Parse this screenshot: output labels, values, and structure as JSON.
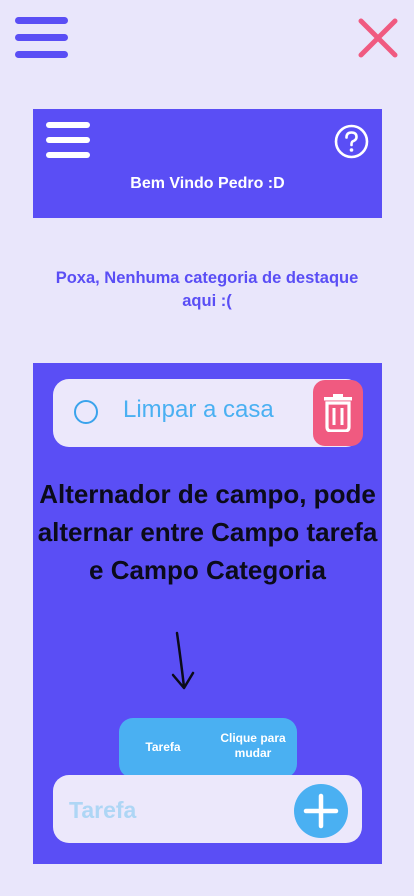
{
  "header": {
    "welcome": "Bem Vindo Pedro :D",
    "menu_icon": "menu-icon",
    "help_icon": "help-circle-icon"
  },
  "top_bar": {
    "menu_icon": "menu-icon",
    "close_icon": "close-icon"
  },
  "highlight_section": {
    "empty_message": "Poxa, Nenhuma categoria de destaque aqui :("
  },
  "tasks": {
    "items": [
      {
        "label": "Limpar a casa",
        "completed": false
      }
    ],
    "delete_icon": "trash-icon"
  },
  "annotation": {
    "text": "Alternador de campo, pode alternar entre Campo tarefa e Campo Categoria"
  },
  "field_toggle": {
    "current_label": "Tarefa",
    "hint_label": "Clique para mudar"
  },
  "input": {
    "placeholder": "Tarefa",
    "add_icon": "plus-icon"
  },
  "colors": {
    "background": "#e9e6fb",
    "primary": "#5a4ef5",
    "accent_blue": "#4ab0f2",
    "danger": "#f05a80"
  }
}
